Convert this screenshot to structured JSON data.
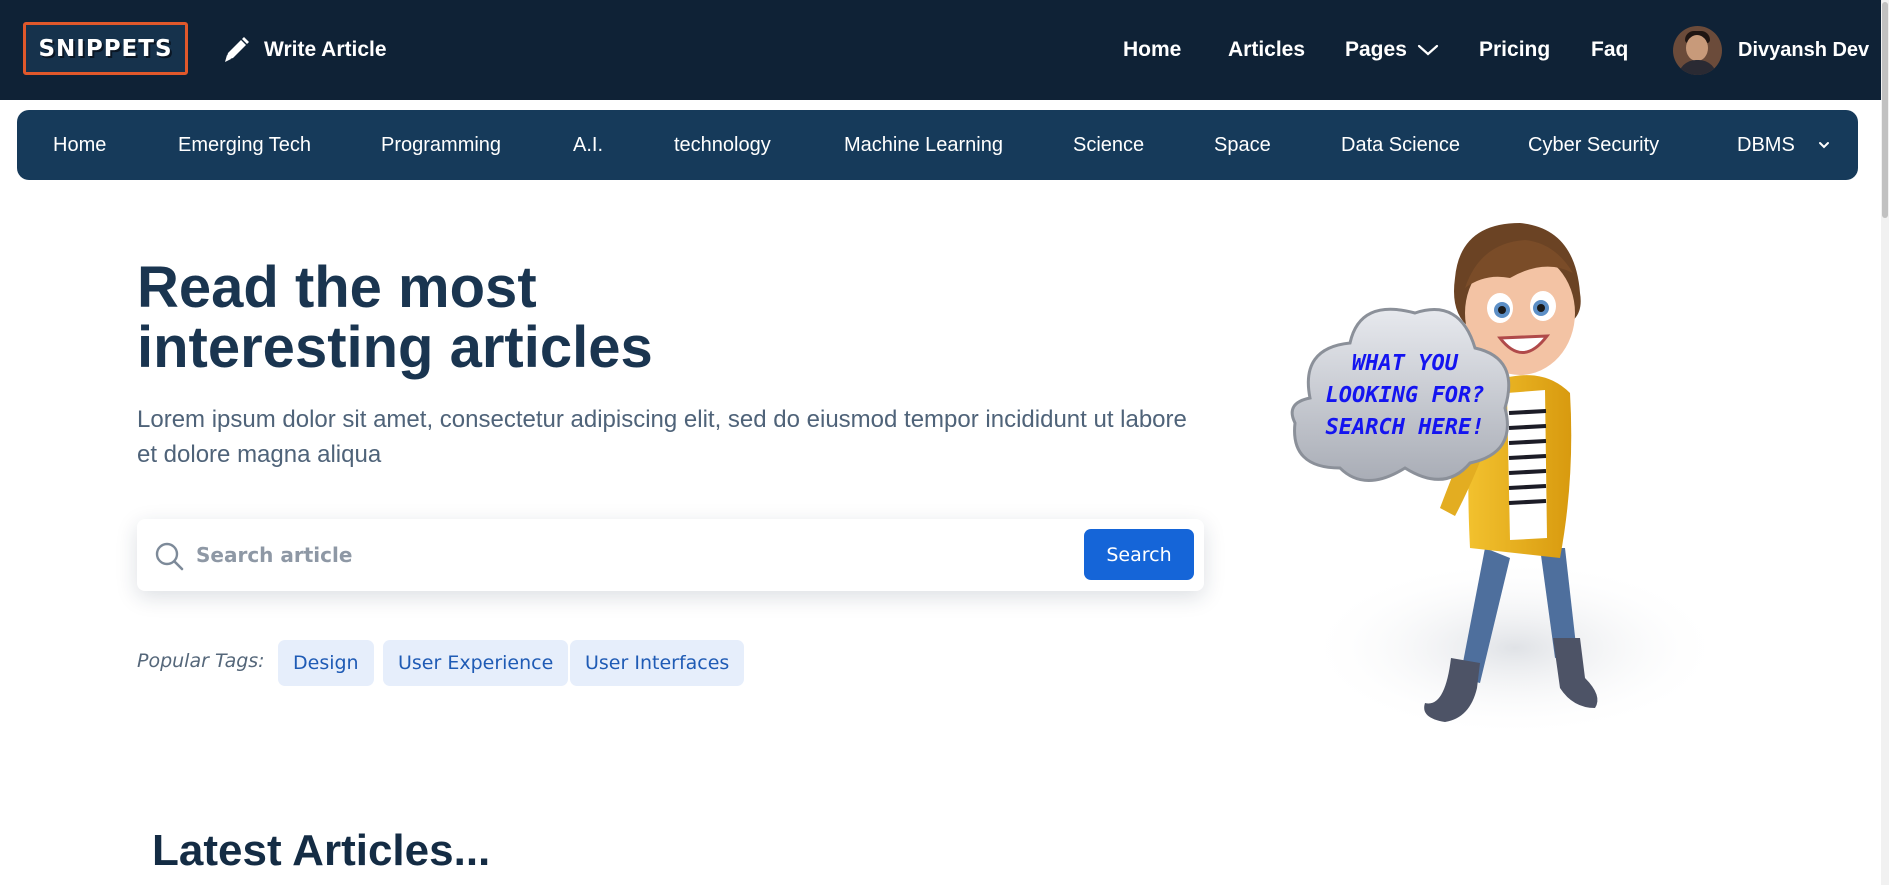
{
  "header": {
    "logo_text": "SNIPPETS",
    "write_article_label": "Write Article",
    "nav": [
      {
        "label": "Home"
      },
      {
        "label": "Articles"
      },
      {
        "label": "Pages"
      },
      {
        "label": "Pricing"
      },
      {
        "label": "Faq"
      }
    ],
    "user_name": "Divyansh Dev"
  },
  "categories": [
    {
      "label": "Home"
    },
    {
      "label": "Emerging Tech"
    },
    {
      "label": "Programming"
    },
    {
      "label": "A.I."
    },
    {
      "label": "technology"
    },
    {
      "label": "Machine Learning"
    },
    {
      "label": "Science"
    },
    {
      "label": "Space"
    },
    {
      "label": "Data Science"
    },
    {
      "label": "Cyber Security"
    },
    {
      "label": "DBMS"
    }
  ],
  "hero": {
    "title_line1": "Read the most",
    "title_line2": "interesting articles",
    "subtitle": "Lorem ipsum dolor sit amet, consectetur adipiscing elit, sed do eiusmod tempor incididunt ut labore et dolore magna aliqua",
    "search_placeholder": "Search article",
    "search_value": "",
    "search_button": "Search",
    "popular_tags_label": "Popular Tags:",
    "tags": [
      "Design",
      "User Experience",
      "User Interfaces"
    ]
  },
  "illustration": {
    "cloud_line1": "WHAT YOU",
    "cloud_line2": "LOOKING FOR?",
    "cloud_line3": "SEARCH HERE!"
  },
  "latest": {
    "heading": "Latest Articles..."
  },
  "colors": {
    "header_bg": "#0f2236",
    "category_bar_bg": "#163a5a",
    "logo_border": "#e0582b",
    "primary_button": "#1565d8",
    "tag_bg": "#e6eefb",
    "tag_text": "#1f5bb5",
    "title_text": "#1a3550"
  },
  "icons": {
    "write": "pen-icon",
    "pages_dropdown": "chevron-down-icon",
    "dbms_dropdown": "chevron-down-icon",
    "search": "search-icon"
  }
}
